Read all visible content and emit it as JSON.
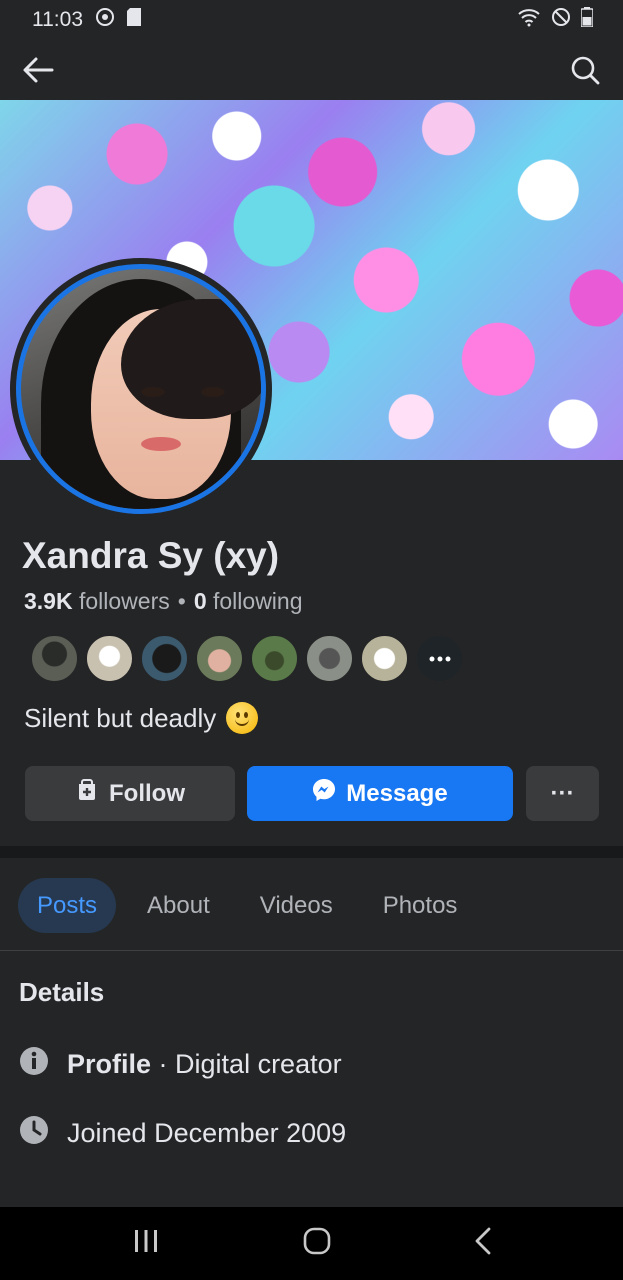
{
  "status_bar": {
    "time": "11:03"
  },
  "profile": {
    "name": "Xandra Sy (xy)",
    "followers_count": "3.9K",
    "followers_label": "followers",
    "separator": "•",
    "following_count": "0",
    "following_label": "following",
    "bio": "Silent but deadly",
    "friend_avatar_colors": [
      "#5b5e55",
      "#c9c1b0",
      "#3c5a6e",
      "#6a7a5a",
      "#5a7a4a",
      "#8a9088",
      "#d8d4c8"
    ]
  },
  "actions": {
    "follow_label": "Follow",
    "message_label": "Message",
    "more_label": "···"
  },
  "tabs": [
    {
      "label": "Posts",
      "active": true
    },
    {
      "label": "About",
      "active": false
    },
    {
      "label": "Videos",
      "active": false
    },
    {
      "label": "Photos",
      "active": false
    }
  ],
  "details": {
    "title": "Details",
    "profile_label": "Profile",
    "profile_value": "· Digital creator",
    "joined": "Joined December 2009"
  },
  "colors": {
    "background": "#242526",
    "accent": "#1877f2",
    "active_tab_bg": "#263951",
    "active_tab_text": "#4599ff"
  },
  "icons": [
    "back-arrow-icon",
    "search-icon",
    "follow-icon",
    "messenger-icon",
    "info-icon",
    "clock-icon",
    "recents-icon",
    "home-icon",
    "back-nav-icon"
  ]
}
